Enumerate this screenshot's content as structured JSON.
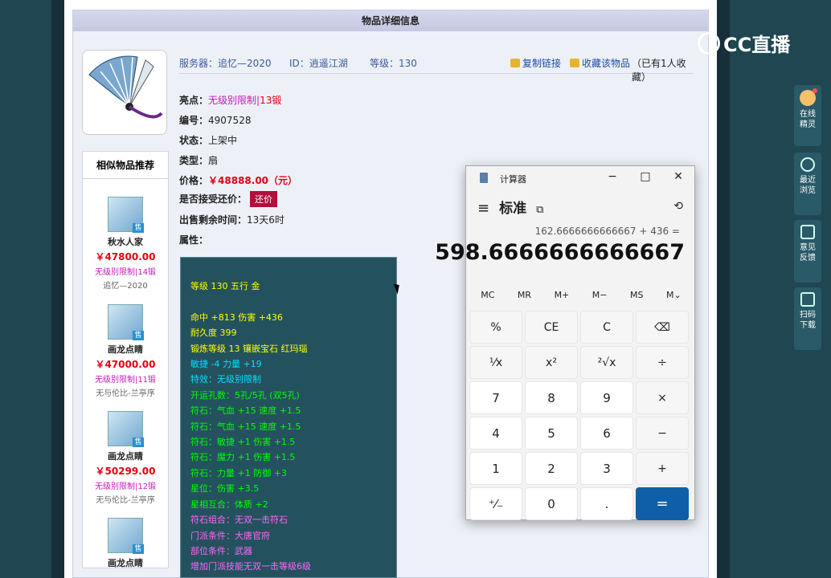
{
  "panel": {
    "title": "物品详细信息"
  },
  "info_bar": {
    "server": "服务器：追忆—2020",
    "id": "ID：逍遥江湖",
    "level": "等级：130",
    "copy_link": "复制链接",
    "favorite": "收藏该物品",
    "fav_count": "（已有1人收藏）"
  },
  "details": {
    "highlight_label": "亮点：",
    "highlight_value": "无级别限制|",
    "highlight_forge": "13锻",
    "serial_label": "编号：",
    "serial_value": "4907528",
    "status_label": "状态：",
    "status_value": "上架中",
    "type_label": "类型：",
    "type_value": "扇",
    "price_label": "价格：",
    "price_value": "￥48888.00（元）",
    "counter_label": "是否接受还价：",
    "counter_button": "还价",
    "time_label": "出售剩余时间：",
    "time_value": "13天6时",
    "attr_label": "属性："
  },
  "attributes": [
    {
      "text": "等级 130 五行 金",
      "color": "yel"
    },
    {
      "text": "",
      "color": "yel"
    },
    {
      "text": "命中 +813 伤害 +436",
      "color": "yel"
    },
    {
      "text": "耐久度 399",
      "color": "yel"
    },
    {
      "text": "锻炼等级 13 镶嵌宝石 红玛瑙",
      "color": "yel"
    },
    {
      "text": "敏捷 -4 力量 +19",
      "color": "cya"
    },
    {
      "text": "特效：无级别限制",
      "color": "cya"
    },
    {
      "text": "开运孔数：5孔/5孔 (双5孔)",
      "color": "grn"
    },
    {
      "text": "符石：气血 +15 速度 +1.5",
      "color": "grn"
    },
    {
      "text": "符石：气血 +15 速度 +1.5",
      "color": "grn"
    },
    {
      "text": "符石：敏捷 +1 伤害 +1.5",
      "color": "grn"
    },
    {
      "text": "符石：魔力 +1 伤害 +1.5",
      "color": "grn"
    },
    {
      "text": "符石：力量 +1 防御 +3",
      "color": "grn"
    },
    {
      "text": "星位：伤害 +3.5",
      "color": "grn"
    },
    {
      "text": "星相互合：体质 +2",
      "color": "grn"
    },
    {
      "text": "符石组合：无双一击符石",
      "color": "mag"
    },
    {
      "text": "门派条件：大唐官府",
      "color": "mag"
    },
    {
      "text": "部位条件：武器",
      "color": "mag"
    },
    {
      "text": "增加门派技能无双一击等级6级",
      "color": "mag"
    }
  ],
  "similar": {
    "title": "相似物品推荐",
    "sell_tag": "售",
    "items": [
      {
        "name": "秋水人家",
        "price": "￥47800.00",
        "tag": "无级别限制|14锻",
        "server": "追忆—2020"
      },
      {
        "name": "画龙点睛",
        "price": "￥47000.00",
        "tag": "无级别限制|11锻",
        "server": "无与伦比-兰亭序"
      },
      {
        "name": "画龙点睛",
        "price": "￥50299.00",
        "tag": "无级别限制|12锻",
        "server": "无与伦比-兰亭序"
      },
      {
        "name": "画龙点睛",
        "price": "",
        "tag": "",
        "server": ""
      }
    ]
  },
  "calculator": {
    "title": "计算器",
    "mode": "标准",
    "expression": "162.6666666666667 + 436 =",
    "display": "598.6666666666667",
    "memory": [
      "MC",
      "MR",
      "M+",
      "M−",
      "MS",
      "M⌄"
    ],
    "keys": [
      "%",
      "CE",
      "C",
      "⌫",
      "¹⁄x",
      "x²",
      "²√x",
      "÷",
      "7",
      "8",
      "9",
      "×",
      "4",
      "5",
      "6",
      "−",
      "1",
      "2",
      "3",
      "+",
      "⁺⁄₋",
      "0",
      ".",
      "="
    ]
  },
  "brand": {
    "logo": "CC直播"
  },
  "side_tools": [
    {
      "label": "在线精灵"
    },
    {
      "label": "最近浏览"
    },
    {
      "label": "意见反馈"
    },
    {
      "label": "扫码下载"
    }
  ]
}
